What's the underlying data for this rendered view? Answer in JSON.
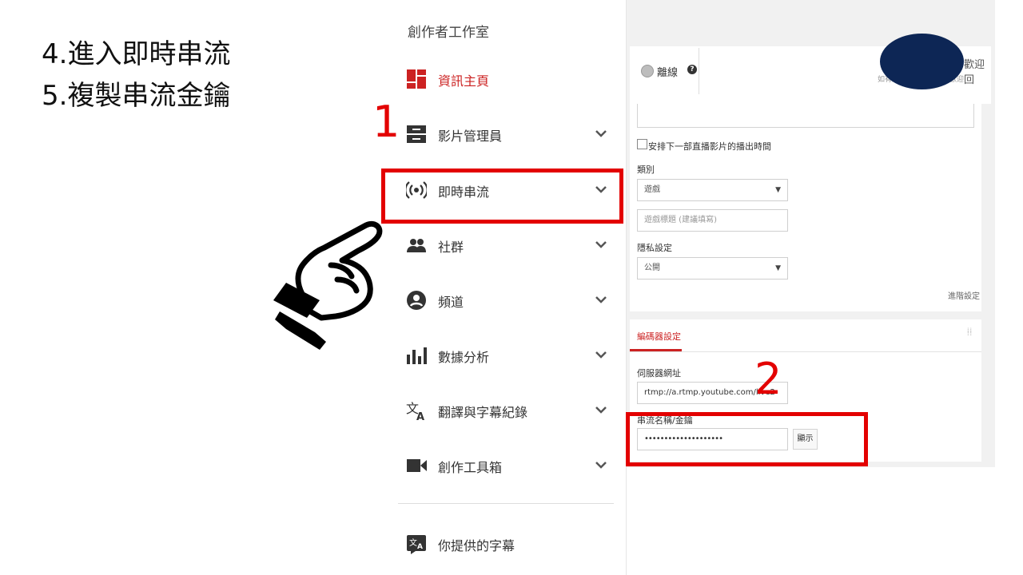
{
  "instructions": {
    "line1": "4.進入即時串流",
    "line2": "5.複製串流金鑰"
  },
  "sidebar": {
    "title": "創作者工作室",
    "items": [
      {
        "label": "資訊主頁",
        "icon": "dashboard-icon"
      },
      {
        "label": "影片管理員",
        "icon": "video-manager-icon"
      },
      {
        "label": "即時串流",
        "icon": "live-broadcast-icon"
      },
      {
        "label": "社群",
        "icon": "community-icon"
      },
      {
        "label": "頻道",
        "icon": "channel-icon"
      },
      {
        "label": "數據分析",
        "icon": "analytics-icon"
      },
      {
        "label": "翻譯與字幕紀錄",
        "icon": "translate-icon"
      },
      {
        "label": "創作工具箱",
        "icon": "video-camera-icon"
      },
      {
        "label": "你提供的字幕",
        "icon": "subtitles-icon"
      }
    ]
  },
  "status": {
    "label": "離線",
    "welcome": "歡迎回",
    "hint": "如有疑問，歡迎問題，歡迎"
  },
  "form": {
    "schedule_next": "安排下一部直播影片的播出時間",
    "category_label": "類別",
    "category_value": "遊戲",
    "game_title_placeholder": "遊戲標題 (建議填寫)",
    "privacy_label": "隱私設定",
    "privacy_value": "公開",
    "advanced_link": "進階設定"
  },
  "encoder": {
    "tab_label": "編碼器設定",
    "server_label": "伺服器網址",
    "server_value": "rtmp://a.rtmp.youtube.com/live2",
    "key_label": "串流名稱/金鑰",
    "key_value": "••••••••••••••••••••",
    "reveal_button": "顯示"
  },
  "annotations": {
    "step1": "1",
    "step2": "2"
  },
  "colors": {
    "accent_red": "#e30000",
    "active_nav": "#cc2222",
    "redaction": "#0d2655"
  }
}
